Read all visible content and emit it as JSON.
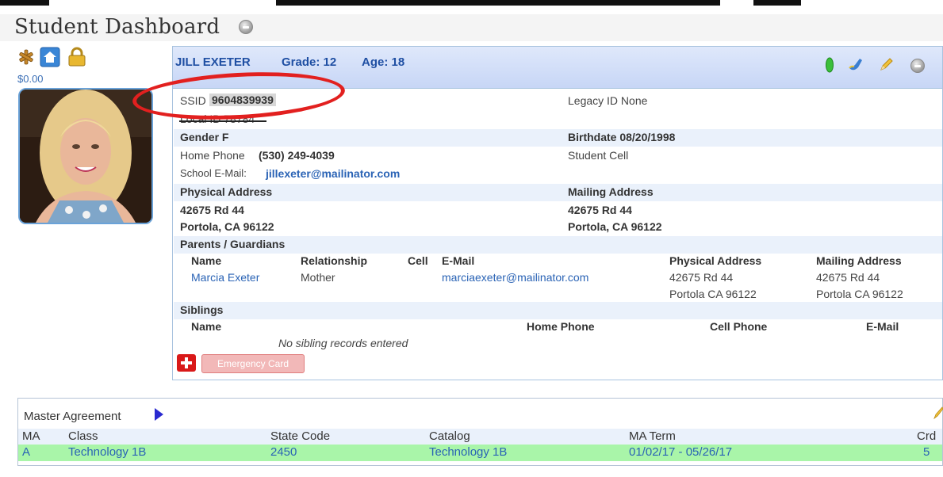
{
  "page": {
    "title": "Student Dashboard"
  },
  "left": {
    "balance": "$0.00"
  },
  "student": {
    "name": "JILL EXETER",
    "grade": "Grade: 12",
    "age": "Age: 18",
    "ssid_label": "SSID",
    "ssid_value": "9604839939",
    "local_id": "Local ID 78784",
    "legacy_id": "Legacy ID None",
    "gender": "Gender F",
    "birthdate": "Birthdate 08/20/1998",
    "home_phone_label": "Home Phone",
    "home_phone": "(530) 249-4039",
    "student_cell_label": "Student Cell",
    "school_email_label": "School E-Mail:",
    "school_email": "jillexeter@mailinator.com",
    "physical_address_label": "Physical Address",
    "mailing_address_label": "Mailing Address",
    "physical_line1": "42675 Rd 44",
    "physical_line2": "Portola, CA 96122",
    "mailing_line1": "42675 Rd 44",
    "mailing_line2": "Portola, CA 96122"
  },
  "parents": {
    "section_label": "Parents / Guardians",
    "headers": {
      "name": "Name",
      "relationship": "Relationship",
      "cell": "Cell",
      "email": "E-Mail",
      "physical": "Physical Address",
      "mailing": "Mailing Address"
    },
    "rows": [
      {
        "name": "Marcia Exeter",
        "relationship": "Mother",
        "email": "marciaexeter@mailinator.com",
        "physical_line1": "42675 Rd 44",
        "physical_line2": "Portola CA 96122",
        "mailing_line1": "42675 Rd 44",
        "mailing_line2": "Portola CA 96122"
      }
    ]
  },
  "siblings": {
    "section_label": "Siblings",
    "headers": {
      "name": "Name",
      "home_phone": "Home Phone",
      "cell_phone": "Cell Phone",
      "email": "E-Mail"
    },
    "empty_message": "No sibling records entered"
  },
  "emergency": {
    "button_label": "Emergency Card"
  },
  "master_agreement": {
    "title": "Master Agreement",
    "headers": {
      "ma": "MA",
      "class": "Class",
      "state_code": "State Code",
      "catalog": "Catalog",
      "term": "MA Term",
      "crd": "Crd"
    },
    "rows": [
      {
        "ma": "A",
        "class": "Technology 1B",
        "state_code": "2450",
        "catalog": "Technology 1B",
        "term": "01/02/17 - 05/26/17",
        "crd": "5"
      }
    ]
  },
  "colors": {
    "accent": "#1f4fa3",
    "link": "#2a63b5",
    "highlight_ellipse": "#e2201f",
    "ma_row": "#a9f5a9"
  },
  "icons": [
    "asterisk-icon",
    "home-icon",
    "lock-icon",
    "info-icon",
    "green-status-icon",
    "edit-icon",
    "pencil-icon"
  ]
}
